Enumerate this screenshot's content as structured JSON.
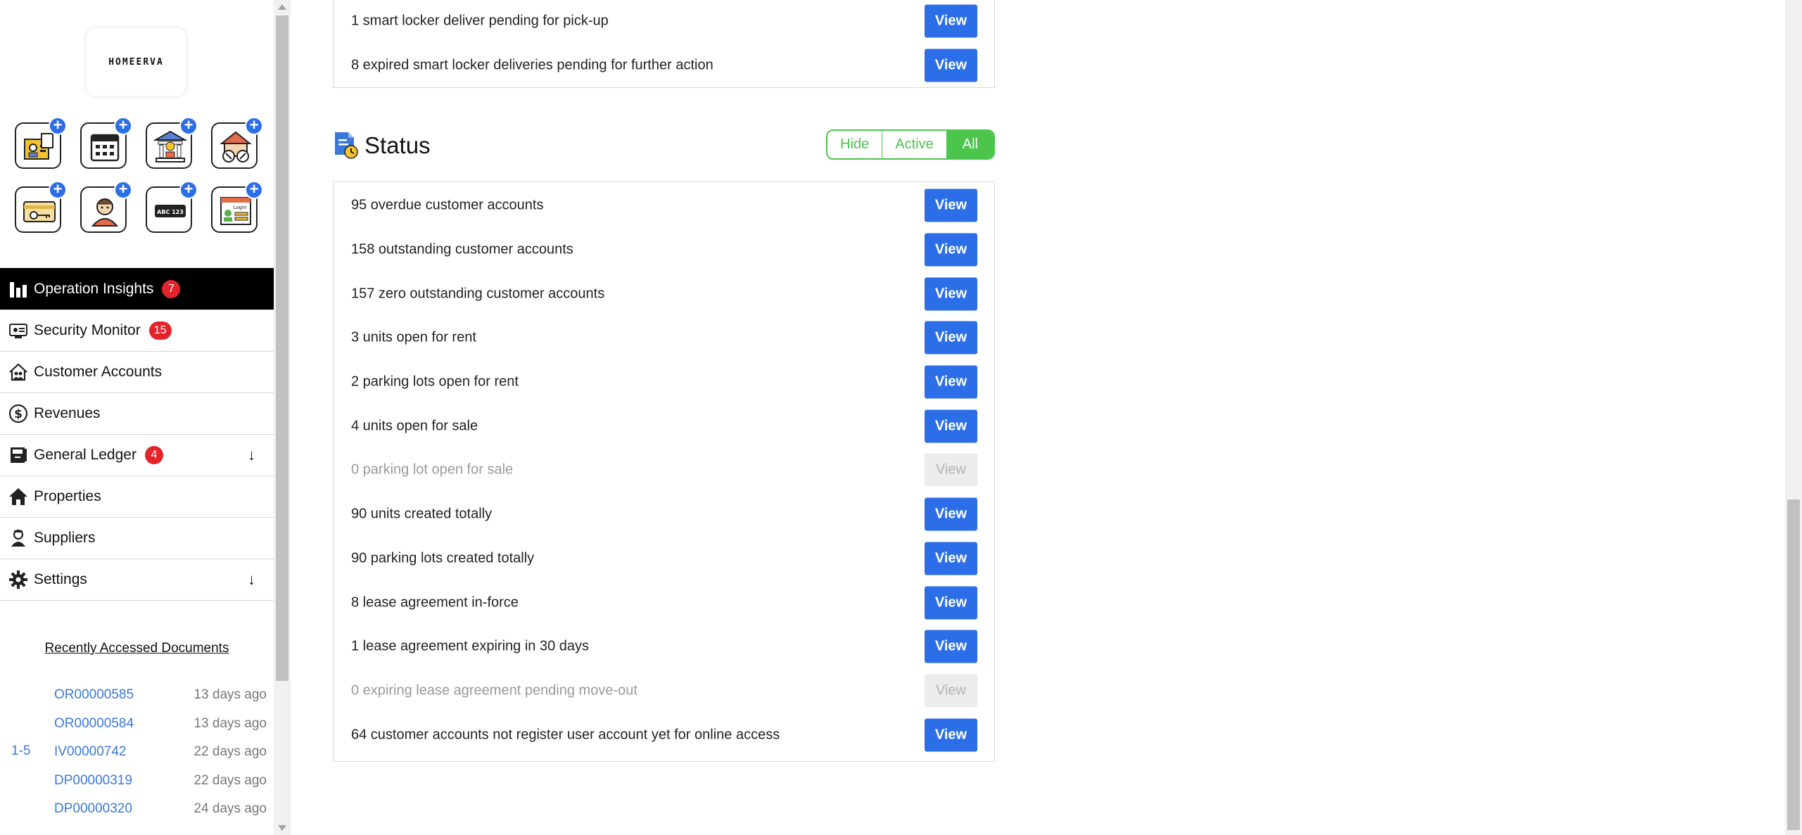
{
  "brand": {
    "logo_text": "HOMEERVA"
  },
  "quick_actions": [
    {
      "icon": "id-card-icon"
    },
    {
      "icon": "calendar-icon"
    },
    {
      "icon": "bank-icon"
    },
    {
      "icon": "property-tools-icon"
    },
    {
      "icon": "keycard-icon"
    },
    {
      "icon": "person-icon"
    },
    {
      "icon": "license-plate-icon"
    },
    {
      "icon": "login-form-icon"
    }
  ],
  "nav": {
    "items": [
      {
        "label": "Operation Insights",
        "badge": "7",
        "icon": "bar-chart-icon"
      },
      {
        "label": "Security Monitor",
        "badge": "15",
        "icon": "monitor-icon"
      },
      {
        "label": "Customer Accounts",
        "icon": "house-people-icon"
      },
      {
        "label": "Revenues",
        "icon": "dollar-icon"
      },
      {
        "label": "General Ledger",
        "badge": "4",
        "caret": "↓",
        "icon": "ledger-icon"
      },
      {
        "label": "Properties",
        "icon": "home-icon"
      },
      {
        "label": "Suppliers",
        "icon": "supplier-icon"
      },
      {
        "label": "Settings",
        "caret": "↓",
        "icon": "gear-icon"
      }
    ]
  },
  "recent": {
    "title": "Recently Accessed Documents",
    "range": "1-5",
    "docs": [
      {
        "id": "OR00000585",
        "ago": "13 days ago"
      },
      {
        "id": "OR00000584",
        "ago": "13 days ago"
      },
      {
        "id": "IV00000742",
        "ago": "22 days ago"
      },
      {
        "id": "DP00000319",
        "ago": "22 days ago"
      },
      {
        "id": "DP00000320",
        "ago": "24 days ago"
      }
    ]
  },
  "locker_card": {
    "rows": [
      {
        "text": "1 smart locker deliver pending for pick-up",
        "button": "View",
        "enabled": true
      },
      {
        "text": "8 expired smart locker deliveries pending for further action",
        "button": "View",
        "enabled": true
      }
    ]
  },
  "status": {
    "title": "Status",
    "filters": [
      "Hide",
      "Active",
      "All"
    ],
    "active_filter": "All",
    "rows": [
      {
        "text": "95 overdue customer accounts",
        "button": "View",
        "enabled": true
      },
      {
        "text": "158 outstanding customer accounts",
        "button": "View",
        "enabled": true
      },
      {
        "text": "157 zero outstanding customer accounts",
        "button": "View",
        "enabled": true
      },
      {
        "text": "3 units open for rent",
        "button": "View",
        "enabled": true
      },
      {
        "text": "2 parking lots open for rent",
        "button": "View",
        "enabled": true
      },
      {
        "text": "4 units open for sale",
        "button": "View",
        "enabled": true
      },
      {
        "text": "0 parking lot open for sale",
        "button": "View",
        "enabled": false
      },
      {
        "text": "90 units created totally",
        "button": "View",
        "enabled": true
      },
      {
        "text": "90 parking lots created totally",
        "button": "View",
        "enabled": true
      },
      {
        "text": "8 lease agreement in-force",
        "button": "View",
        "enabled": true
      },
      {
        "text": "1 lease agreement expiring in 30 days",
        "button": "View",
        "enabled": true
      },
      {
        "text": "0 expiring lease agreement pending move-out",
        "button": "View",
        "enabled": false
      },
      {
        "text": "64 customer accounts not register user account yet for online access",
        "button": "View",
        "enabled": true
      }
    ]
  },
  "colors": {
    "primary": "#2b6ee8",
    "accent_green": "#4cc54c",
    "badge_red": "#e3242b",
    "nav_active_bg": "#000000"
  }
}
